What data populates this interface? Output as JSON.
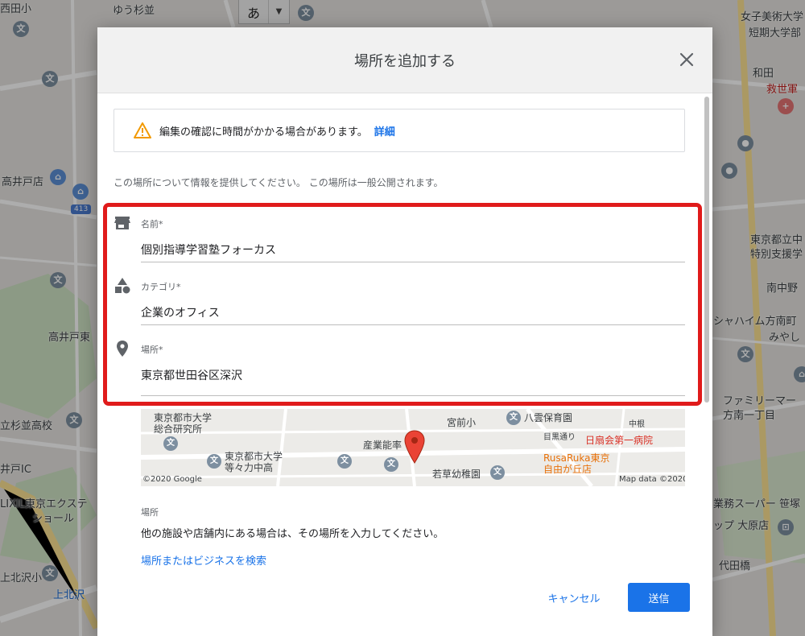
{
  "background_map": {
    "labels": [
      {
        "text": "西田小"
      },
      {
        "text": "ゆう杉並"
      },
      {
        "text": "女子美術大学"
      },
      {
        "text": "短期大学部"
      },
      {
        "text": "和田"
      },
      {
        "text": "救世軍"
      },
      {
        "text": "高井戸店"
      },
      {
        "text": "東京都立中"
      },
      {
        "text": "特別支援学"
      },
      {
        "text": "南中野"
      },
      {
        "text": "シャハイム方南町"
      },
      {
        "text": "みやし"
      },
      {
        "text": "高井戸東"
      },
      {
        "text": "立杉並高校"
      },
      {
        "text": "ファミリーマー"
      },
      {
        "text": "方南一丁目"
      },
      {
        "text": "井戸IC"
      },
      {
        "text": "LIXIL東京エクステ"
      },
      {
        "text": "ショール"
      },
      {
        "text": "業務スーパー 笹塚"
      },
      {
        "text": "ップ 大原店"
      },
      {
        "text": "代田橋"
      },
      {
        "text": "上北沢小"
      },
      {
        "text": "上北沢"
      }
    ],
    "ime_char": "あ",
    "route_badge": "413"
  },
  "dialog": {
    "title": "場所を追加する",
    "notice_text": "編集の確認に時間がかかる場合があります。",
    "notice_link": "詳細",
    "intro": "この場所について情報を提供してください。 この場所は一般公開されます。",
    "fields": {
      "name": {
        "label": "名前*",
        "value": "個別指導学習塾フォーカス"
      },
      "category": {
        "label": "カテゴリ*",
        "value": "企業のオフィス"
      },
      "location": {
        "label": "場所*",
        "value": "東京都世田谷区深沢"
      }
    },
    "map_preview": {
      "labels": [
        "東京都市大学",
        "総合研究所",
        "宮前小",
        "八雲保育園",
        "中根",
        "目黒通り",
        "日扇会第一病院",
        "東京都市大学",
        "等々力中高",
        "産業能率",
        "RusaRuka東京",
        "自由が丘店",
        "若草幼稚園"
      ],
      "copyright_left": "©2020 Google",
      "copyright_right": "Map data ©2020"
    },
    "section_label": "場所",
    "section_help": "他の施設や店舗内にある場合は、その場所を入力してください。",
    "search_link": "場所またはビジネスを検索",
    "cancel_label": "キャンセル",
    "submit_label": "送信"
  },
  "colors": {
    "accent": "#1a73e8",
    "highlight": "#e01b1b",
    "warning": "#f29900",
    "map_pin": "#ea4335"
  }
}
